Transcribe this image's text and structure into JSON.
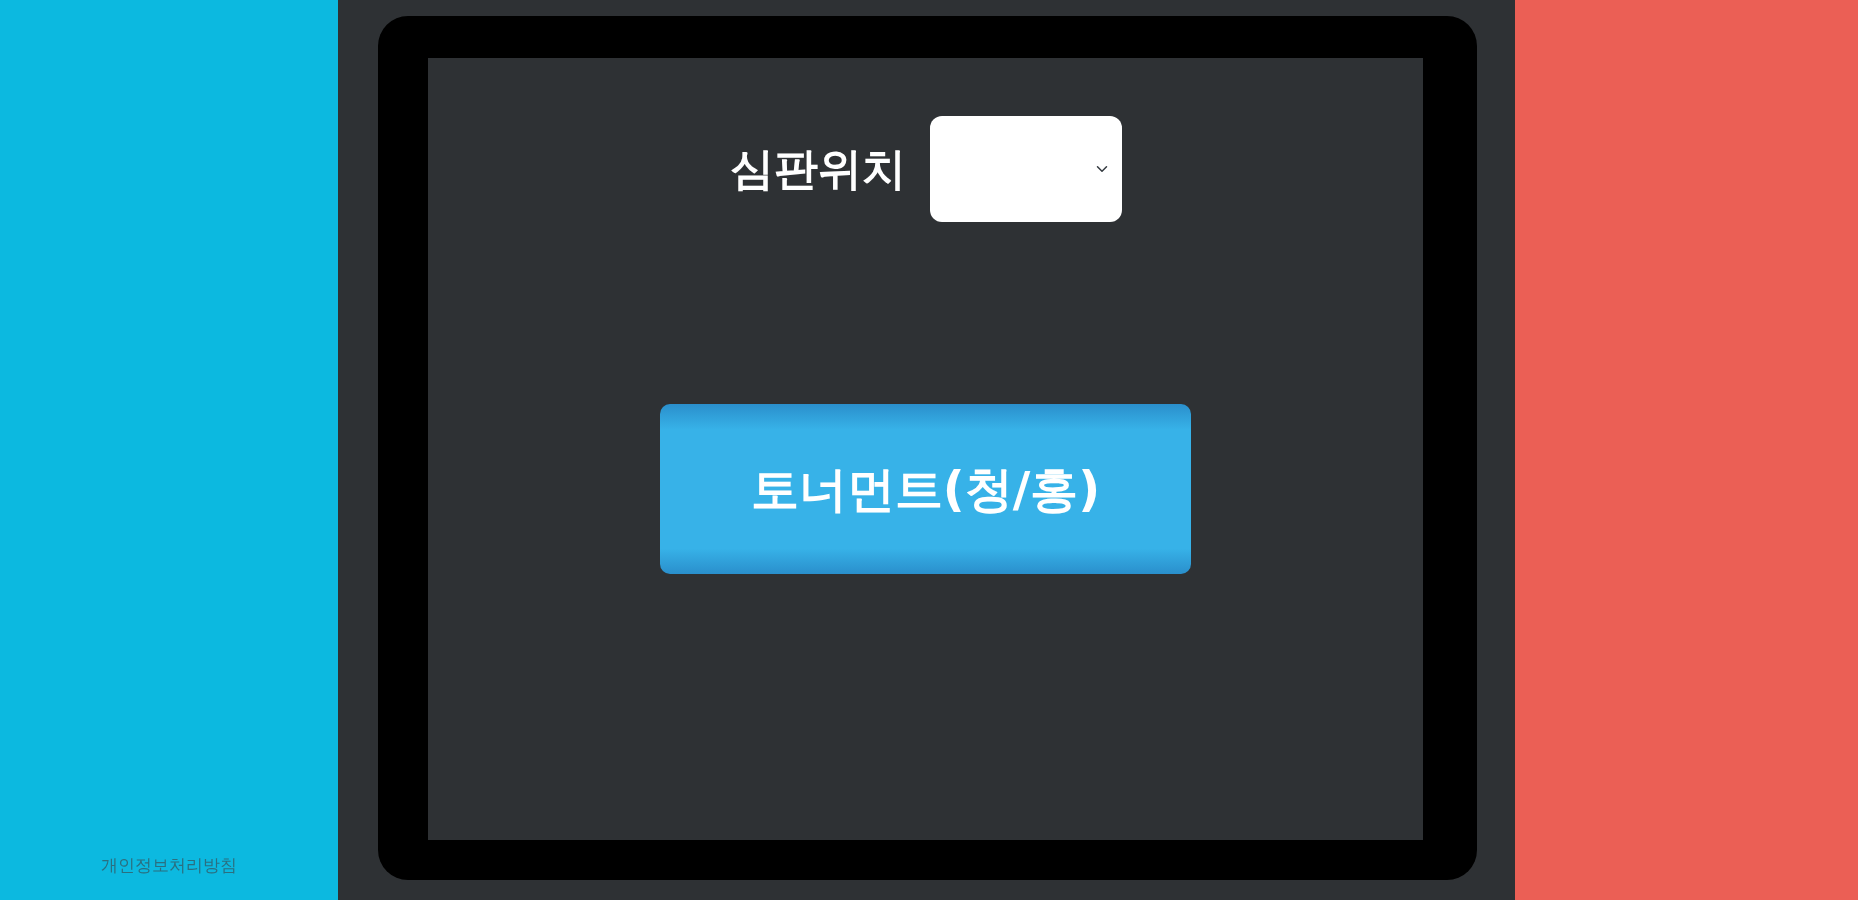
{
  "referee_position": {
    "label": "심판위치"
  },
  "tournament_button": {
    "label": "토너먼트(청/홍)"
  },
  "footer": {
    "privacy_link": "개인정보처리방침"
  }
}
